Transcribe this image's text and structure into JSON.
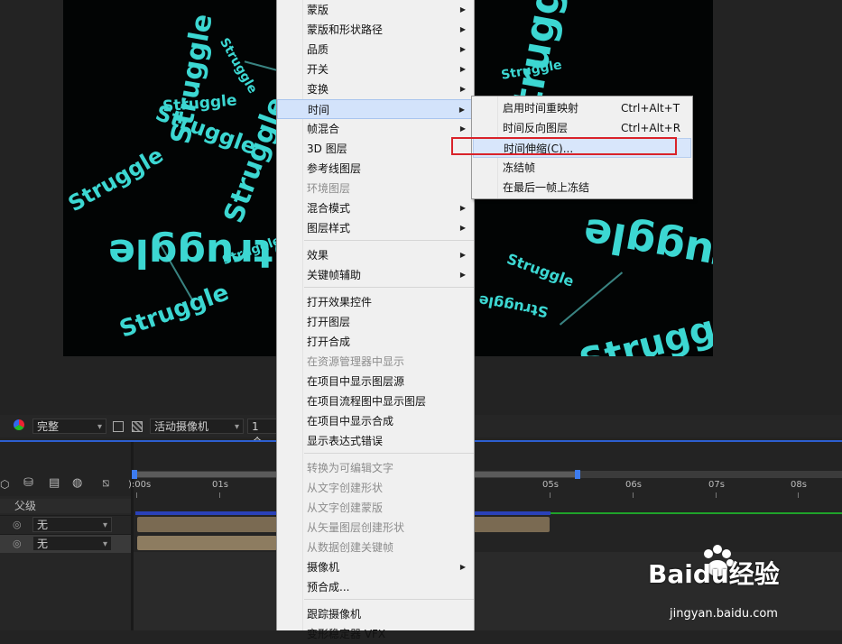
{
  "composition": {
    "words": [
      "Struggle",
      "Struggle",
      "Struggle",
      "Struggle",
      "Struggle",
      "Struggle",
      "Struggle",
      "Struggle",
      "Struggle",
      "Struggle",
      "Struggle",
      "Struggle",
      "Struggle",
      "Struggle",
      "Struggle"
    ]
  },
  "context_menu": {
    "items": [
      {
        "label": "蒙版",
        "submenu": true,
        "enabled": true
      },
      {
        "label": "蒙版和形状路径",
        "submenu": true,
        "enabled": true
      },
      {
        "label": "品质",
        "submenu": true,
        "enabled": true
      },
      {
        "label": "开关",
        "submenu": true,
        "enabled": true
      },
      {
        "label": "变换",
        "submenu": true,
        "enabled": true
      },
      {
        "label": "时间",
        "submenu": true,
        "enabled": true,
        "highlighted": true
      },
      {
        "label": "帧混合",
        "submenu": true,
        "enabled": true
      },
      {
        "label": "3D 图层",
        "submenu": false,
        "enabled": true
      },
      {
        "label": "参考线图层",
        "submenu": false,
        "enabled": true
      },
      {
        "label": "环境图层",
        "submenu": false,
        "enabled": false
      },
      {
        "label": "混合模式",
        "submenu": true,
        "enabled": true
      },
      {
        "label": "图层样式",
        "submenu": true,
        "enabled": true
      },
      {
        "label": "效果",
        "submenu": true,
        "enabled": true
      },
      {
        "label": "关键帧辅助",
        "submenu": true,
        "enabled": true
      },
      {
        "label": "打开效果控件",
        "submenu": false,
        "enabled": true
      },
      {
        "label": "打开图层",
        "submenu": false,
        "enabled": true
      },
      {
        "label": "打开合成",
        "submenu": false,
        "enabled": true
      },
      {
        "label": "在资源管理器中显示",
        "submenu": false,
        "enabled": false
      },
      {
        "label": "在项目中显示图层源",
        "submenu": false,
        "enabled": true
      },
      {
        "label": "在项目流程图中显示图层",
        "submenu": false,
        "enabled": true
      },
      {
        "label": "在项目中显示合成",
        "submenu": false,
        "enabled": true
      },
      {
        "label": "显示表达式错误",
        "submenu": false,
        "enabled": true
      },
      {
        "label": "转换为可编辑文字",
        "submenu": false,
        "enabled": false
      },
      {
        "label": "从文字创建形状",
        "submenu": false,
        "enabled": false
      },
      {
        "label": "从文字创建蒙版",
        "submenu": false,
        "enabled": false
      },
      {
        "label": "从矢量图层创建形状",
        "submenu": false,
        "enabled": false
      },
      {
        "label": "从数据创建关键帧",
        "submenu": false,
        "enabled": false
      },
      {
        "label": "摄像机",
        "submenu": true,
        "enabled": true
      },
      {
        "label": "预合成...",
        "submenu": false,
        "enabled": true
      },
      {
        "label": "跟踪摄像机",
        "submenu": false,
        "enabled": true
      },
      {
        "label": "变形稳定器 VFX",
        "submenu": false,
        "enabled": true
      }
    ]
  },
  "time_submenu": {
    "items": [
      {
        "label": "启用时间重映射",
        "shortcut": "Ctrl+Alt+T"
      },
      {
        "label": "时间反向图层",
        "shortcut": "Ctrl+Alt+R"
      },
      {
        "label": "时间伸缩(C)...",
        "shortcut": "",
        "highlighted": true
      },
      {
        "label": "冻结帧",
        "shortcut": ""
      },
      {
        "label": "在最后一帧上冻结",
        "shortcut": ""
      }
    ]
  },
  "timeline": {
    "quality_select": "完整",
    "camera_select": "活动摄像机",
    "view_select": "1个...",
    "parent_header": "父级",
    "layer_rows": [
      {
        "parent": "无"
      },
      {
        "parent": "无"
      }
    ],
    "ticks": [
      "):00s",
      "01s",
      "05s",
      "06s",
      "07s",
      "08s"
    ]
  },
  "watermark": {
    "brand": "Baidu经验",
    "url": "jingyan.baidu.com"
  },
  "colors": {
    "text_glow": "#3cd7d2",
    "highlight_border": "#d9232a",
    "timeline_accent": "#2d5fd0"
  }
}
